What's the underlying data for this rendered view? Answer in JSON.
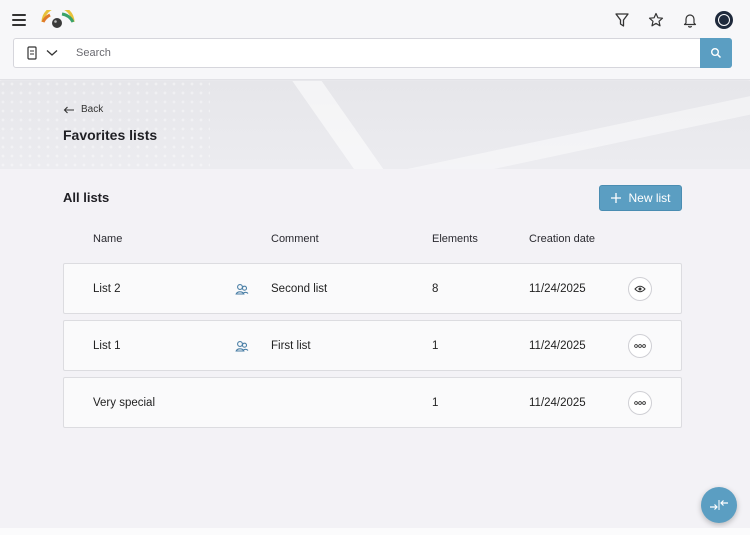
{
  "search": {
    "placeholder": "Search"
  },
  "back": {
    "label": "Back"
  },
  "page": {
    "title": "Favorites lists"
  },
  "section": {
    "title": "All lists",
    "new_button_label": "New list"
  },
  "table": {
    "headers": {
      "name": "Name",
      "comment": "Comment",
      "elements": "Elements",
      "creation_date": "Creation date"
    },
    "rows": [
      {
        "name": "List 2",
        "shared": true,
        "comment": "Second list",
        "elements": "8",
        "creation_date": "11/24/2025",
        "action": "view-icon"
      },
      {
        "name": "List 1",
        "shared": true,
        "comment": "First list",
        "elements": "1",
        "creation_date": "11/24/2025",
        "action": "more-icon"
      },
      {
        "name": "Very special",
        "shared": false,
        "comment": "",
        "elements": "1",
        "creation_date": "11/24/2025",
        "action": "more-icon"
      }
    ]
  },
  "colors": {
    "accent": "#5b9ec2",
    "background": "#f3f2f6",
    "banner": "#e8e8ec"
  }
}
